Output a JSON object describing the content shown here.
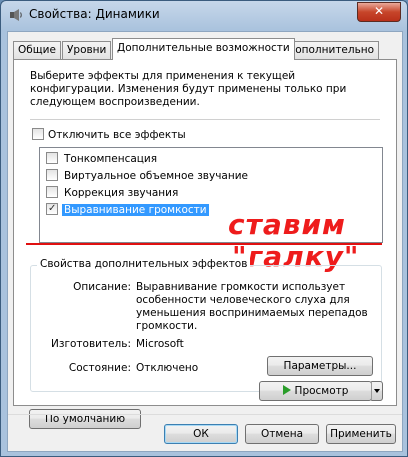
{
  "window": {
    "title": "Свойства: Динамики",
    "close_label": "✕"
  },
  "tabs": [
    {
      "label": "Общие"
    },
    {
      "label": "Уровни"
    },
    {
      "label": "Дополнительные возможности"
    },
    {
      "label": "Дополнительно"
    }
  ],
  "enhancements": {
    "description": "Выберите эффекты для применения к текущей конфигурации. Изменения будут применены только при следующем воспроизведении.",
    "disable_all_label": "Отключить все эффекты",
    "disable_all_checked": false,
    "items": [
      {
        "label": "Тонкомпенсация",
        "checked": false,
        "selected": false
      },
      {
        "label": "Виртуальное объемное звучание",
        "checked": false,
        "selected": false
      },
      {
        "label": "Коррекция звучания",
        "checked": false,
        "selected": false
      },
      {
        "label": "Выравнивание громкости",
        "checked": true,
        "selected": true
      }
    ]
  },
  "annotation": {
    "line1": "ставим",
    "line2": "\"галку\"",
    "color": "#ee1c1c"
  },
  "properties": {
    "group_title": "Свойства дополнительных эффектов",
    "description_label": "Описание:",
    "description_value": "Выравнивание громкости использует особенности человеческого слуха для уменьшения воспринимаемых перепадов громкости.",
    "manufacturer_label": "Изготовитель:",
    "manufacturer_value": "Microsoft",
    "state_label": "Состояние:",
    "state_value": "Отключено",
    "settings_button": "Параметры..."
  },
  "actions": {
    "defaults_button": "По умолчанию",
    "preview_button": "Просмотр"
  },
  "footer": {
    "ok_button": "ОК",
    "cancel_button": "Отмена",
    "apply_button": "Применить"
  }
}
